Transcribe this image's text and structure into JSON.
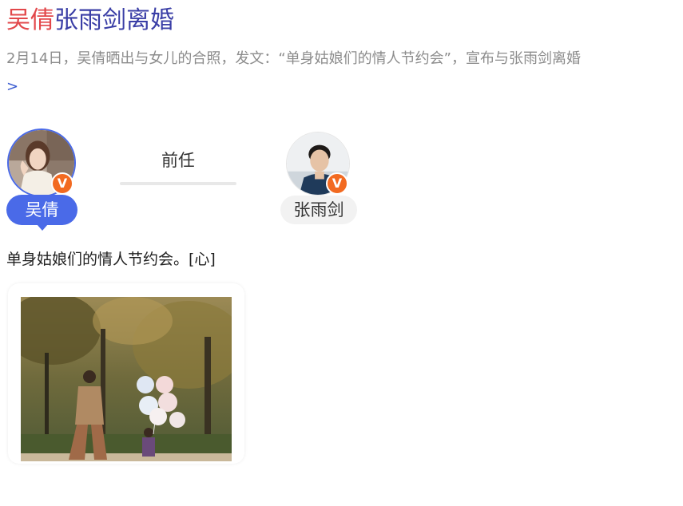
{
  "headline": {
    "name_highlight": "吴倩",
    "rest": "张雨剑离婚"
  },
  "summary": {
    "text": "2月14日，吴倩晒出与女儿的合照，发文：“单身姑娘们的情人节约会”，宣布与张雨剑离婚",
    "more_arrow": ">"
  },
  "relation": {
    "label": "前任",
    "person_a": {
      "name": "吴倩",
      "verified_badge": "V",
      "avatar_icon": "avatar-photo-woman"
    },
    "person_b": {
      "name": "张雨剑",
      "verified_badge": "V",
      "avatar_icon": "avatar-photo-man"
    }
  },
  "post": {
    "text": "单身姑娘们的情人节约会。[心]",
    "image_icon": "photo-woman-child-balloons-park"
  },
  "colors": {
    "highlight_red": "#e2474a",
    "headline_blue": "#3a3ea6",
    "accent_blue": "#4a6ae8",
    "verified_orange": "#f26a21",
    "summary_gray": "#8c8c8c"
  }
}
